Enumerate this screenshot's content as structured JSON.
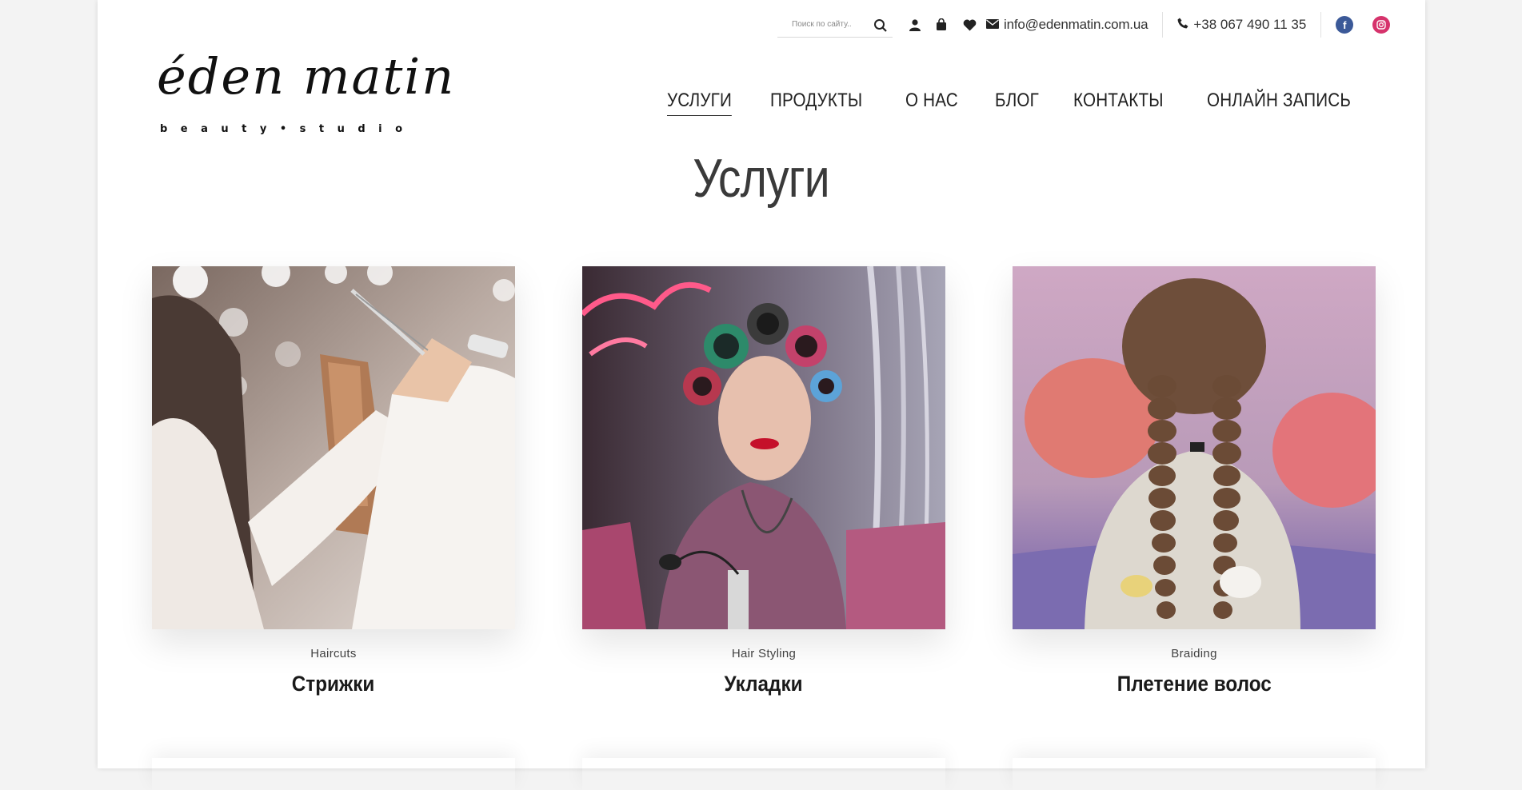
{
  "header": {
    "search": {
      "placeholder": "Поиск по сайту.."
    },
    "icons": [
      "search-icon",
      "user-icon",
      "bag-icon",
      "heart-icon",
      "mail-icon",
      "phone-icon"
    ],
    "email": "info@edenmatin.com.ua",
    "phone": "+38 067 490 11 35",
    "social": [
      {
        "name": "facebook",
        "glyph": "f",
        "color": "#3b5998"
      },
      {
        "name": "instagram",
        "glyph": "◎",
        "color": "#d6336c"
      }
    ]
  },
  "logo": {
    "wordmark": "éden matin",
    "tagline": "beauty•studio"
  },
  "nav": {
    "items": [
      {
        "label": "УСЛУГИ",
        "active": true
      },
      {
        "label": "ПРОДУКТЫ"
      },
      {
        "label": "О НАС"
      },
      {
        "label": "БЛОГ"
      },
      {
        "label": "КОНТАКТЫ"
      },
      {
        "label": "ОНЛАЙН ЗАПИСЬ"
      }
    ]
  },
  "page_title": "Услуги",
  "services": [
    {
      "subtitle": "Haircuts",
      "title": "Стрижки"
    },
    {
      "subtitle": "Hair Styling",
      "title": "Укладки"
    },
    {
      "subtitle": "Braiding",
      "title": "Плетение волос"
    }
  ]
}
